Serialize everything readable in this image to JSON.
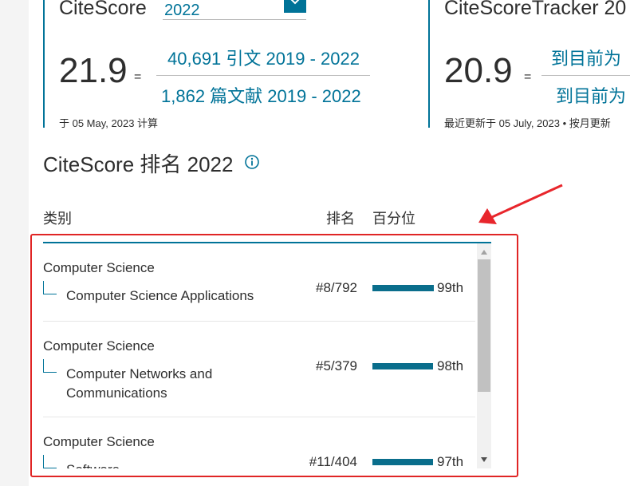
{
  "citescore_card": {
    "title": "CiteScore",
    "year": "2022",
    "score": "21.9",
    "equals": "=",
    "numerator": "40,691 引文 2019 - 2022",
    "denominator": "1,862 篇文献 2019 - 2022",
    "note": "于 05 May, 2023 计算"
  },
  "tracker_card": {
    "title": "CiteScoreTracker 20",
    "score": "20.9",
    "equals": "=",
    "numerator": "到目前为",
    "denominator": "到目前为",
    "note": "最近更新于 05 July, 2023 • 按月更新"
  },
  "ranking": {
    "heading": "CiteScore 排名 2022",
    "columns": {
      "category": "类别",
      "rank": "排名",
      "percentile": "百分位"
    },
    "rows": [
      {
        "category": "Computer Science",
        "subcategory": "Computer Science Applications",
        "rank": "#8/792",
        "percentile_label": "99th",
        "percentile": 0.99
      },
      {
        "category": "Computer Science",
        "subcategory": "Computer Networks and Communications",
        "rank": "#5/379",
        "percentile_label": "98th",
        "percentile": 0.98
      },
      {
        "category": "Computer Science",
        "subcategory": "Software",
        "rank": "#11/404",
        "percentile_label": "97th",
        "percentile": 0.97
      }
    ]
  },
  "colors": {
    "accent": "#007398",
    "bar": "#0a6e8c",
    "highlight": "#e02525"
  },
  "icons": {
    "select": "chevron-down-icon",
    "info": "info-icon",
    "annotation": "red-arrow"
  }
}
